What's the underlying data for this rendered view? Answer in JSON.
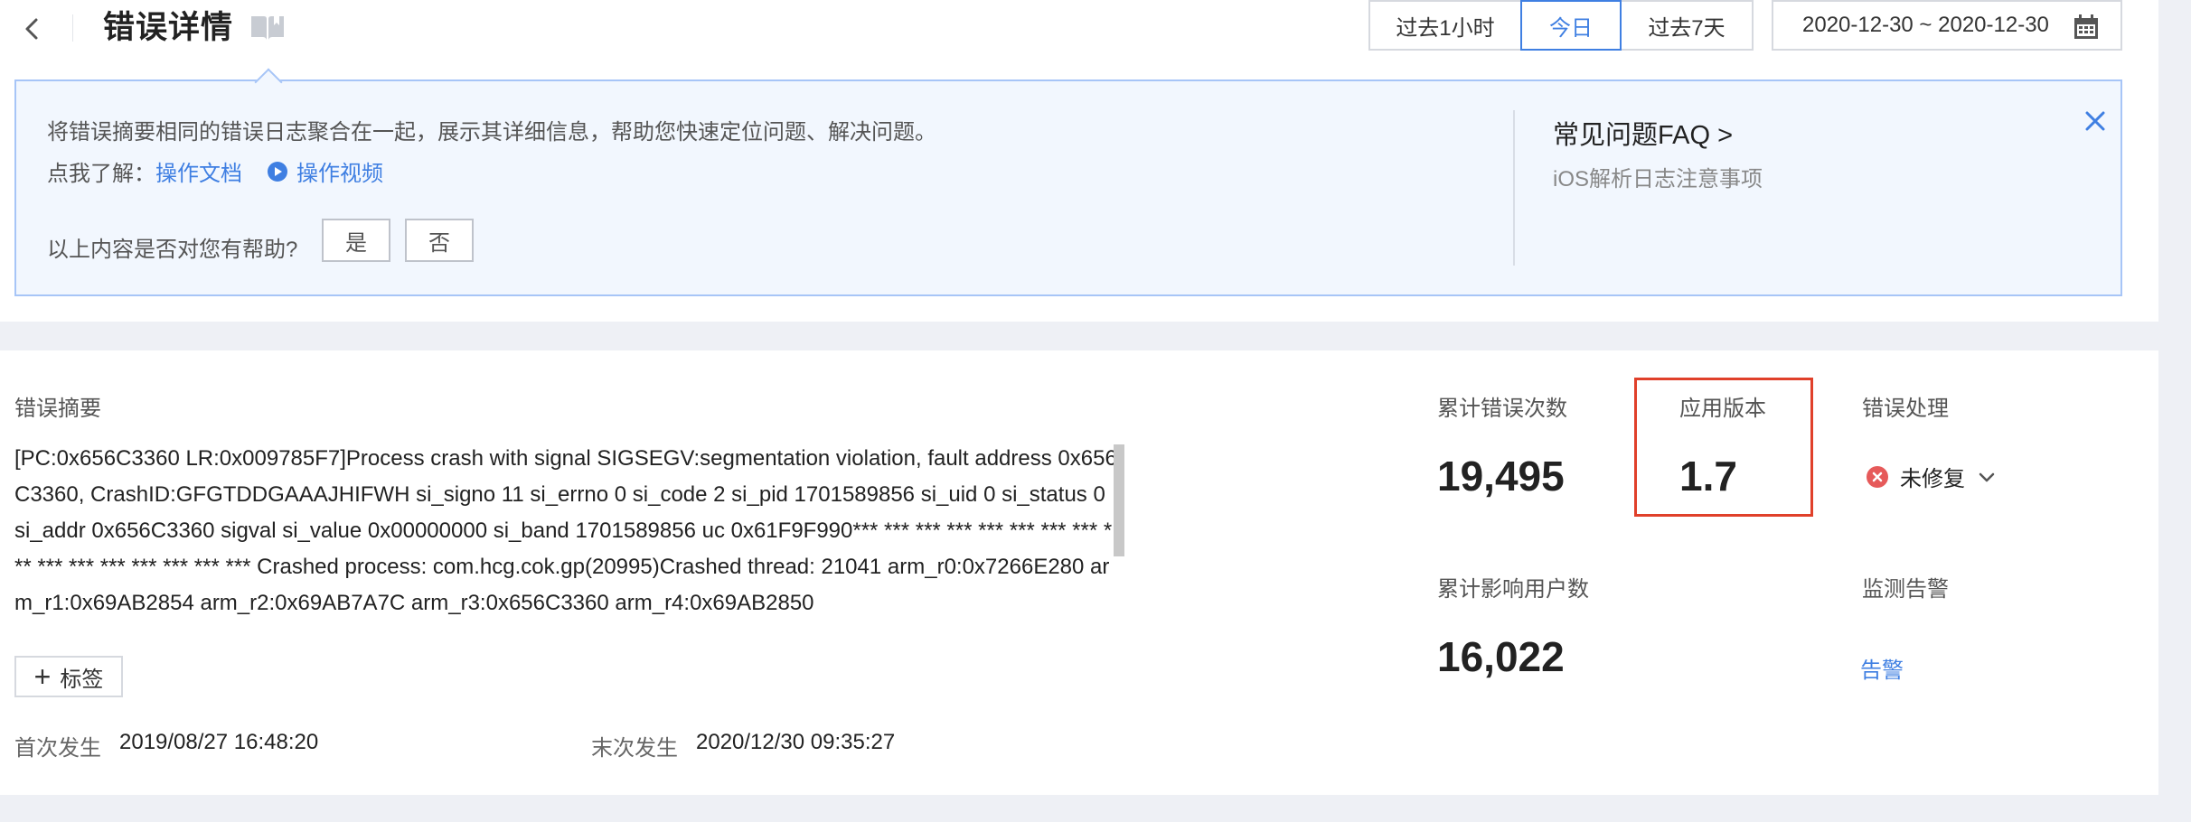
{
  "header": {
    "title": "错误详情",
    "time_filters": [
      "过去1小时",
      "今日",
      "过去7天"
    ],
    "active_filter_index": 1,
    "date_range": "2020-12-30 ~ 2020-12-30"
  },
  "notice": {
    "text": "将错误摘要相同的错误日志聚合在一起，展示其详细信息，帮助您快速定位问题、解决问题。",
    "learn_label": "点我了解：",
    "doc_link": "操作文档",
    "video_link": "操作视频",
    "helpful_question": "以上内容是否对您有帮助?",
    "yes": "是",
    "no": "否",
    "faq_title": "常见问题FAQ >",
    "faq_item": "iOS解析日志注意事项"
  },
  "summary": {
    "title": "错误摘要",
    "text": "[PC:0x656C3360 LR:0x009785F7]Process crash with signal SIGSEGV:segmentation violation, fault address 0x656C3360, CrashID:GFGTDDGAAAJHIFWH si_signo 11 si_errno 0 si_code 2 si_pid 1701589856 si_uid 0 si_status 0 si_addr 0x656C3360 sigval si_value 0x00000000 si_band 1701589856 uc 0x61F9F990*** *** *** *** *** *** *** *** *** *** *** *** *** *** *** *** Crashed process: com.hcg.cok.gp(20995)Crashed thread: 21041 arm_r0:0x7266E280 arm_r1:0x69AB2854 arm_r2:0x69AB7A7C arm_r3:0x656C3360 arm_r4:0x69AB2850",
    "tag_button": "标签",
    "first_label": "首次发生",
    "first_value": "2019/08/27 16:48:20",
    "last_label": "末次发生",
    "last_value": "2020/12/30 09:35:27"
  },
  "stats": {
    "total_errors_label": "累计错误次数",
    "total_errors_value": "19,495",
    "app_version_label": "应用版本",
    "app_version_value": "1.7",
    "handling_label": "错误处理",
    "handling_status": "未修复",
    "affected_users_label": "累计影响用户数",
    "affected_users_value": "16,022",
    "monitor_label": "监测告警",
    "monitor_link": "告警"
  },
  "colors": {
    "accent": "#3f7fe2",
    "highlight": "#e0402a",
    "status_error": "#e65a5a"
  }
}
